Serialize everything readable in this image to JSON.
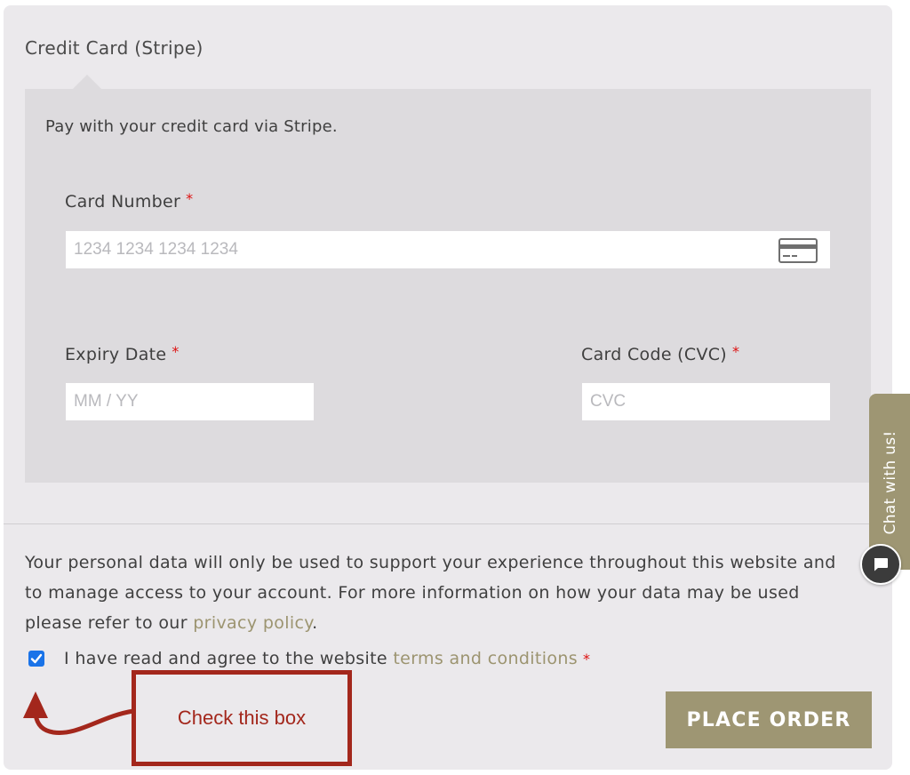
{
  "payment": {
    "method_title": "Credit Card (Stripe)",
    "description": "Pay with your credit card via Stripe.",
    "card_number": {
      "label": "Card Number",
      "required_mark": "*",
      "placeholder": "1234 1234 1234 1234",
      "icon": "credit-card-icon"
    },
    "expiry": {
      "label": "Expiry Date",
      "required_mark": "*",
      "placeholder": "MM / YY"
    },
    "cvc": {
      "label": "Card Code (CVC)",
      "required_mark": "*",
      "placeholder": "CVC"
    }
  },
  "privacy": {
    "text_before": "Your personal data will only be used to support your experience throughout this website and to manage access to your account. For more information on how your data may be used please refer to our ",
    "link_text": "privacy policy",
    "text_after": "."
  },
  "terms": {
    "checked": true,
    "text_before": "I have read and agree to the website ",
    "link_text": "terms and conditions",
    "required_mark": "*"
  },
  "place_order_label": "PLACE ORDER",
  "annotation": {
    "text": "Check this box",
    "color": "#a3271c"
  },
  "chat": {
    "tab_label": "Chat with us!",
    "icon": "chat-bubble-icon"
  },
  "colors": {
    "accent": "#9e9673",
    "checkbox": "#1a73e8",
    "panel": "#ebe9ec",
    "stripe_box": "#dddbde",
    "required": "#dd1111"
  }
}
